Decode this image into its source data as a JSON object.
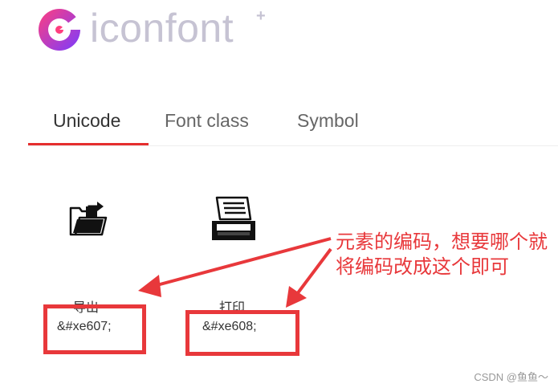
{
  "brand": {
    "name": "iconfont",
    "plus": "+"
  },
  "tabs": [
    {
      "label": "Unicode",
      "active": true
    },
    {
      "label": "Font class",
      "active": false
    },
    {
      "label": "Symbol",
      "active": false
    }
  ],
  "icons": [
    {
      "icon": "export-folder-icon",
      "name": "导出",
      "code": "&#xe607;"
    },
    {
      "icon": "printer-icon",
      "name": "打印",
      "code": "&#xe608;"
    }
  ],
  "annotation": {
    "line1": "元素的编码，想要哪个就",
    "line2": "将编码改成这个即可"
  },
  "watermark": "CSDN @鱼鱼～",
  "colors": {
    "accent": "#e52e2e",
    "annotation": "#e8383b",
    "logo_purple": "#7a3cff",
    "logo_pink": "#ff3e7f"
  }
}
